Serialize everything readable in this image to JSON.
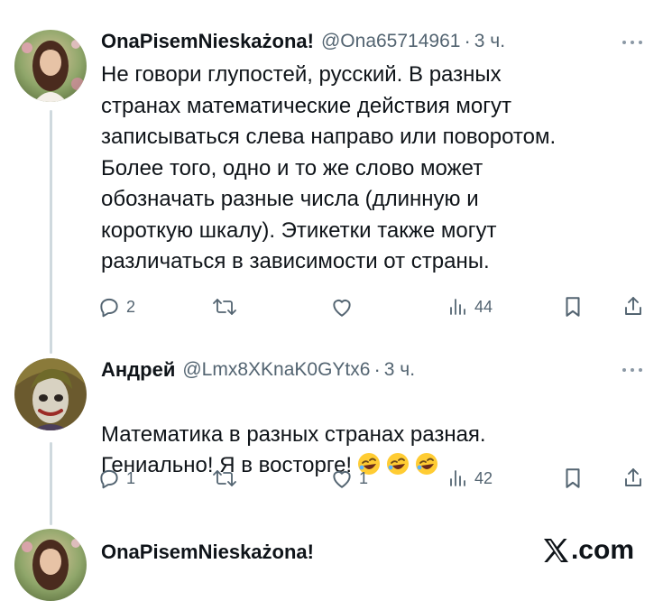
{
  "tweets": [
    {
      "display_name": "OnaPisemNieskażona!",
      "handle": "@Ona65714961",
      "separator": "·",
      "time": "3 ч.",
      "text": "Не говори глупостей, русский. В разных\nстранах математические действия могут\nзаписываться слева направо или поворотом.\nБолее того, одно и то же слово может\nобозначать разные числа (длинную и\nкороткую шкалу). Этикетки также могут\nразличаться в зависимости от страны.",
      "reply_count": "2",
      "retweet_count": "",
      "like_count": "",
      "view_count": "44"
    },
    {
      "display_name": "Андрей",
      "handle": "@Lmx8XKnaK0GYtx6",
      "separator": "·",
      "time": "3 ч.",
      "text": "Математика в разных странах разная.\nГениально! Я в восторге!",
      "emoji": [
        "rolling-on-floor-laughing",
        "rolling-on-floor-laughing",
        "rolling-on-floor-laughing"
      ],
      "reply_count": "1",
      "retweet_count": "",
      "like_count": "1",
      "view_count": "42"
    },
    {
      "display_name": "OnaPisemNieskażona!"
    }
  ],
  "watermark": {
    "text": ".com"
  },
  "colors": {
    "text": "#0f1419",
    "secondary": "#536471",
    "thread_line": "#cfd9de"
  },
  "icons": [
    "reply-icon",
    "retweet-icon",
    "like-icon",
    "views-icon",
    "bookmark-icon",
    "share-icon",
    "more-icon",
    "x-logo-icon"
  ]
}
